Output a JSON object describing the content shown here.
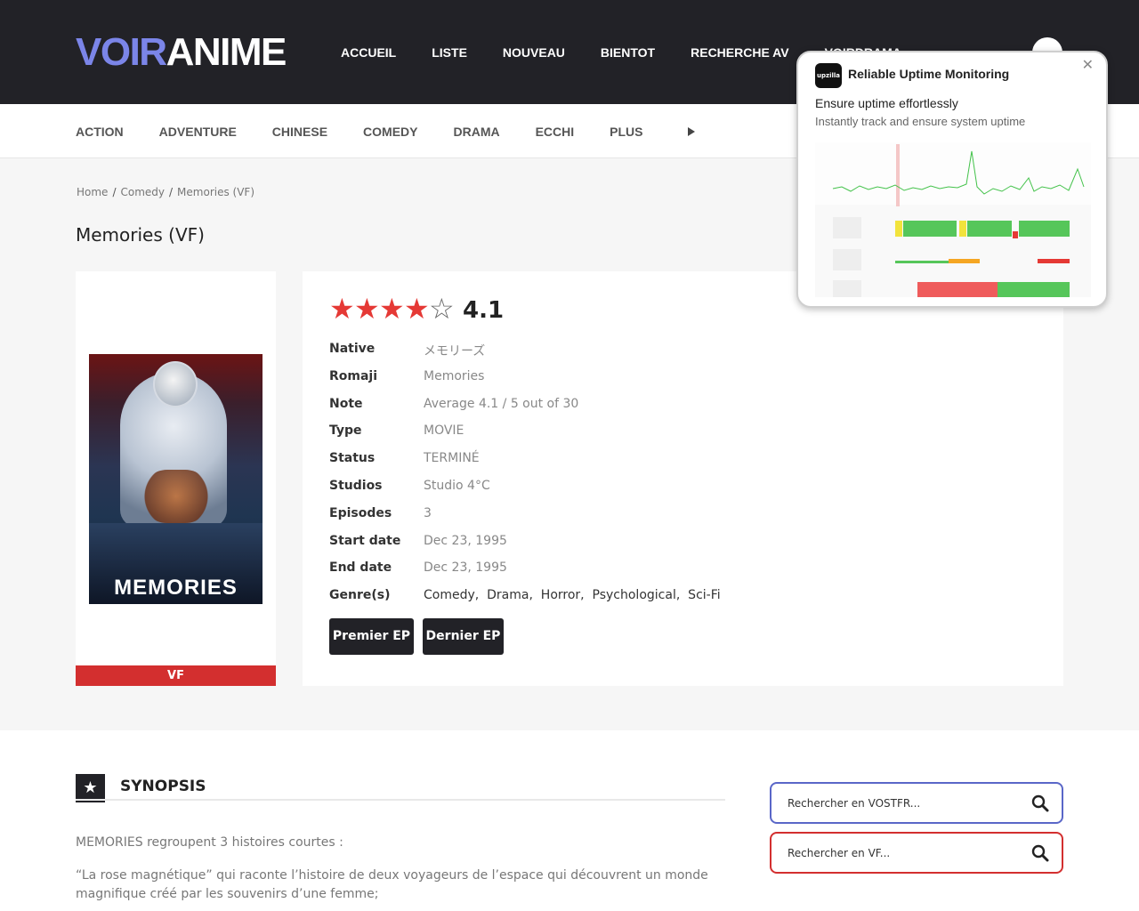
{
  "header": {
    "logo_part1": "VOIR",
    "logo_part2": "ANIME",
    "nav": [
      "ACCUEIL",
      "LISTE",
      "NOUVEAU",
      "BIENTOT",
      "RECHERCHE AV",
      "VOIRDRAMA"
    ]
  },
  "genres": [
    "ACTION",
    "ADVENTURE",
    "CHINESE",
    "COMEDY",
    "DRAMA",
    "ECCHI",
    "PLUS"
  ],
  "breadcrumb": [
    "Home",
    "Comedy",
    "Memories (VF)"
  ],
  "title": "Memories (VF)",
  "poster": {
    "text": "MEMORIES",
    "badge": "VF"
  },
  "rating": {
    "stars_filled": 4,
    "stars_total": 5,
    "score": "4.1"
  },
  "details": [
    {
      "key": "Native",
      "value": "メモリーズ"
    },
    {
      "key": "Romaji",
      "value": "Memories"
    },
    {
      "key": "Note",
      "value": "Average 4.1 / 5 out of 30"
    },
    {
      "key": "Type",
      "value": "MOVIE"
    },
    {
      "key": "Status",
      "value": "TERMINÉ"
    },
    {
      "key": "Studios",
      "value": "Studio 4°C"
    },
    {
      "key": "Episodes",
      "value": "3"
    },
    {
      "key": "Start date",
      "value": "Dec 23, 1995"
    },
    {
      "key": "End date",
      "value": "Dec 23, 1995"
    },
    {
      "key": "Genre(s)",
      "value": "Comedy,  Drama,  Horror,  Psychological,  Sci-Fi"
    }
  ],
  "buttons": {
    "first": "Premier EP",
    "last": "Dernier EP"
  },
  "synopsis": {
    "title": "SYNOPSIS",
    "p1": "MEMORIES regroupent 3 histoires courtes :",
    "p2": "“La rose magnétique” qui raconte l’histoire de deux voyageurs de l’espace qui découvrent un monde magnifique créé par les souvenirs d’une femme;"
  },
  "search": {
    "vostfr_placeholder": "Rechercher en VOSTFR...",
    "vf_placeholder": "Rechercher en VF...",
    "vostfr_border": "#5a67c8",
    "vf_border": "#d32f2f"
  },
  "ad": {
    "logo": "upzilla",
    "title": "Reliable Uptime Monitoring",
    "heading": "Ensure uptime effortlessly",
    "subheading": "Instantly track and ensure system uptime",
    "close": "✕"
  },
  "colors": {
    "accent": "#7b85e8",
    "dark": "#222227",
    "red": "#e53935"
  }
}
